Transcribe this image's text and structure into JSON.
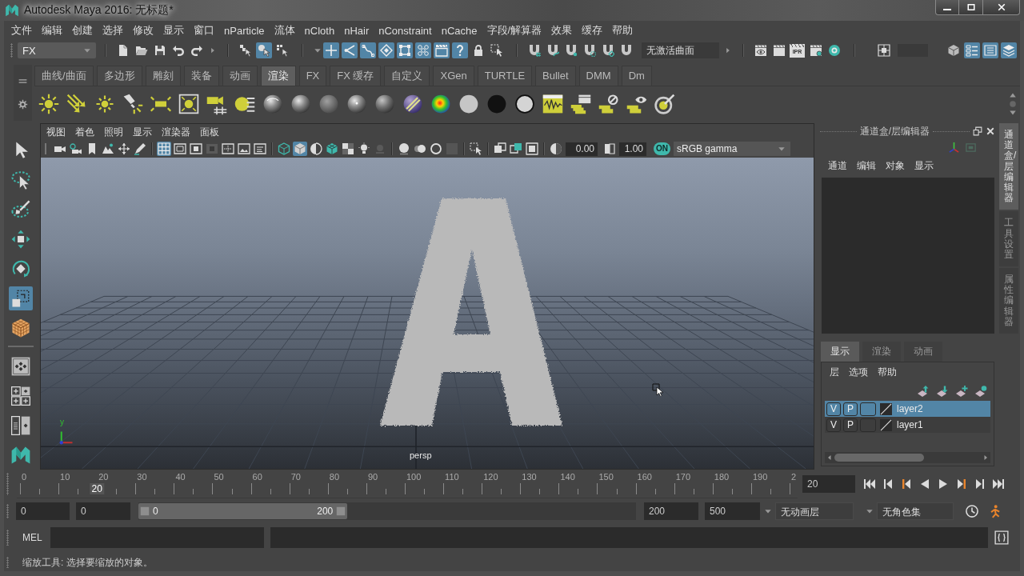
{
  "window": {
    "title": "Autodesk Maya 2016: 无标题*"
  },
  "menu_bar": [
    "文件",
    "编辑",
    "创建",
    "选择",
    "修改",
    "显示",
    "窗口",
    "nParticle",
    "流体",
    "nCloth",
    "nHair",
    "nConstraint",
    "nCache",
    "字段/解算器",
    "效果",
    "缓存",
    "帮助"
  ],
  "status_line": {
    "menu_set": "FX",
    "selection_modes": [
      {
        "on": false
      },
      {
        "on": true
      },
      {
        "on": false
      }
    ],
    "selection_masks": [
      {
        "on": true
      },
      {
        "on": true
      },
      {
        "on": true
      },
      {
        "on": true
      },
      {
        "on": true
      },
      {
        "on": true
      },
      {
        "on": true
      },
      {
        "on": true
      }
    ],
    "live_surface": "无激活曲面",
    "ipr_label": "IPR",
    "panel_toggles": [
      {
        "on": true
      },
      {
        "on": true
      },
      {
        "on": true
      }
    ]
  },
  "shelf": {
    "tabs": [
      {
        "label": "曲线/曲面",
        "selected": false
      },
      {
        "label": "多边形",
        "selected": false
      },
      {
        "label": "雕刻",
        "selected": false
      },
      {
        "label": "装备",
        "selected": false
      },
      {
        "label": "动画",
        "selected": false
      },
      {
        "label": "渲染",
        "selected": true
      },
      {
        "label": "FX",
        "selected": false
      },
      {
        "label": "FX 缓存",
        "selected": false
      },
      {
        "label": "自定义",
        "selected": false
      },
      {
        "label": "XGen",
        "selected": false
      },
      {
        "label": "TURTLE",
        "selected": false
      },
      {
        "label": "Bullet",
        "selected": false
      },
      {
        "label": "DMM",
        "selected": false
      },
      {
        "label": "Dm",
        "selected": false
      }
    ]
  },
  "tool_box": {
    "tools": [
      {
        "selected": false
      },
      {
        "selected": false
      },
      {
        "selected": false
      },
      {
        "selected": false
      },
      {
        "selected": false
      },
      {
        "selected": true
      },
      {
        "selected": false
      }
    ]
  },
  "viewport": {
    "menu": [
      "视图",
      "着色",
      "照明",
      "显示",
      "渲染器",
      "面板"
    ],
    "toolbar_toggles": [
      {
        "on": false
      },
      {
        "on": false
      },
      {
        "on": false
      },
      {
        "on": false
      },
      {
        "on": false
      },
      {
        "on": false
      },
      {
        "on": true
      },
      {
        "on": false
      },
      {
        "on": false
      },
      {
        "on": false
      },
      {
        "on": false
      },
      {
        "on": false
      },
      {
        "on": false
      },
      {
        "on": false
      },
      {
        "on": true
      },
      {
        "on": false
      },
      {
        "on": false
      },
      {
        "on": false
      },
      {
        "on": false
      },
      {
        "on": false
      },
      {
        "on": false
      },
      {
        "on": false
      },
      {
        "on": false
      },
      {
        "on": false
      },
      {
        "on": false
      },
      {
        "on": false
      },
      {
        "on": false
      },
      {
        "on": false
      }
    ],
    "exposure": "0.00",
    "gamma": "1.00",
    "color_management": {
      "label": "ON",
      "on": true
    },
    "color_space": "sRGB gamma",
    "axis_label": "y",
    "camera": "persp"
  },
  "channel_box": {
    "title": "通道盒/层编辑器",
    "menu": [
      "通道",
      "编辑",
      "对象",
      "显示"
    ]
  },
  "side_tabs": [
    {
      "label": "通道盒/层编辑器",
      "selected": true
    },
    {
      "label": "工具设置",
      "selected": false
    },
    {
      "label": "属性编辑器",
      "selected": false
    }
  ],
  "layer_editor": {
    "tabs": [
      {
        "label": "显示",
        "selected": true
      },
      {
        "label": "渲染",
        "selected": false
      },
      {
        "label": "动画",
        "selected": false
      }
    ],
    "menu": [
      "层",
      "选项",
      "帮助"
    ],
    "layers": [
      {
        "visibility": "V",
        "playback": "P",
        "name": "layer2",
        "selected": true
      },
      {
        "visibility": "V",
        "playback": "P",
        "name": "layer1",
        "selected": false
      }
    ]
  },
  "time_slider": {
    "ticks": [
      "0",
      "10",
      "20",
      "30",
      "40",
      "50",
      "60",
      "70",
      "80",
      "90",
      "100",
      "110",
      "120",
      "130",
      "140",
      "150",
      "160",
      "170",
      "180",
      "190",
      "2"
    ],
    "current_frame": "20",
    "level": 0.1,
    "frame_field": "20"
  },
  "range_slider": {
    "start_frame": "0",
    "playback_start": "0",
    "range_start": "0",
    "range_end": "200",
    "level": 0.42,
    "playback_end": "200",
    "end_frame": "500",
    "anim_layer": "无动画层",
    "character_set": "无角色集"
  },
  "command_line": {
    "language": "MEL"
  },
  "help_line": "缩放工具: 选择要缩放的对象。"
}
